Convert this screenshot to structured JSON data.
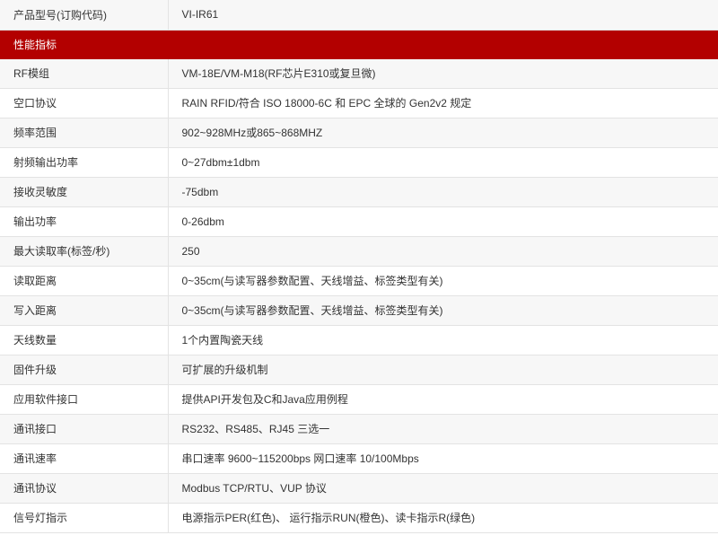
{
  "model_row": {
    "label": "产品型号(订购代码)",
    "value": "VI-IR61"
  },
  "section_title": "性能指标",
  "colors": {
    "section_bg": "#b30000",
    "border": "#e3e3e3",
    "row_alt": "#f7f7f7"
  },
  "rows": [
    {
      "label": "RF模组",
      "value": "VM-18E/VM-M18(RF芯片E310或复旦微)"
    },
    {
      "label": "空口协议",
      "value": "RAIN RFID/符合 ISO 18000-6C 和 EPC 全球的 Gen2v2 规定"
    },
    {
      "label": "频率范围",
      "value": "902~928MHz或865~868MHZ"
    },
    {
      "label": "射频输出功率",
      "value": "0~27dbm±1dbm"
    },
    {
      "label": "接收灵敏度",
      "value": "-75dbm"
    },
    {
      "label": "输出功率",
      "value": "0-26dbm"
    },
    {
      "label": "最大读取率(标签/秒)",
      "value": "250"
    },
    {
      "label": "读取距离",
      "value": "0~35cm(与读写器参数配置、天线增益、标签类型有关)"
    },
    {
      "label": "写入距离",
      "value": "0~35cm(与读写器参数配置、天线增益、标签类型有关)"
    },
    {
      "label": "天线数量",
      "value": "1个内置陶瓷天线"
    },
    {
      "label": "固件升级",
      "value": "可扩展的升级机制"
    },
    {
      "label": "应用软件接口",
      "value": "提供API开发包及C和Java应用例程"
    },
    {
      "label": "通讯接口",
      "value": "RS232、RS485、RJ45 三选一"
    },
    {
      "label": "通讯速率",
      "value": "串口速率 9600~115200bps  网口速率 10/100Mbps"
    },
    {
      "label": "通讯协议",
      "value": "Modbus TCP/RTU、VUP 协议"
    },
    {
      "label": "信号灯指示",
      "value": "电源指示PER(红色)、 运行指示RUN(橙色)、读卡指示R(绿色)"
    }
  ]
}
